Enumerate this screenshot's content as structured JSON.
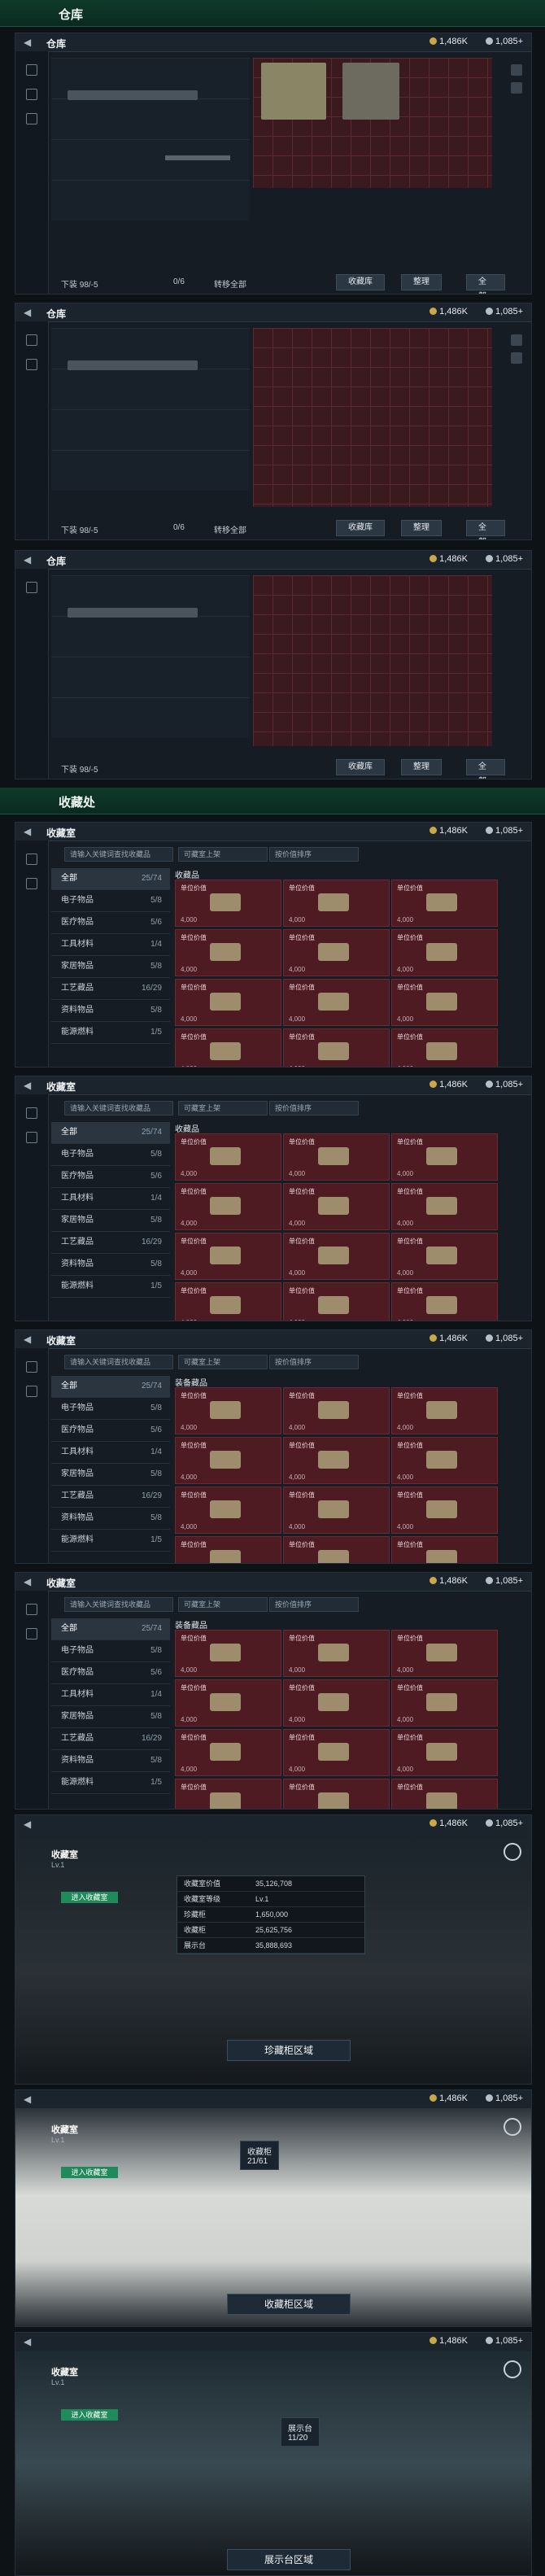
{
  "sections": {
    "warehouse": "仓库",
    "collection": "收藏处"
  },
  "currency": {
    "a": "1,486K",
    "b": "1,085+"
  },
  "warehouse": {
    "title": "仓库",
    "footer": {
      "left": "下装 98/-5",
      "mid": "0/6",
      "right": "转移全部"
    },
    "buttons": [
      "收藏库",
      "整理",
      "全部"
    ]
  },
  "collection": {
    "title": "收藏室",
    "search_placeholder": "请输入关键词查找收藏品",
    "filter1": "可藏室上架",
    "filter2": "按价值排序",
    "section1": "收藏品",
    "section2": "装备藏品",
    "categories": [
      {
        "label": "全部",
        "count": "25/74"
      },
      {
        "label": "电子物品",
        "count": "5/8"
      },
      {
        "label": "医疗物品",
        "count": "5/6"
      },
      {
        "label": "工具材料",
        "count": "1/4"
      },
      {
        "label": "家居物品",
        "count": "5/8"
      },
      {
        "label": "工艺藏品",
        "count": "16/29"
      },
      {
        "label": "资料物品",
        "count": "5/8"
      },
      {
        "label": "能源燃料",
        "count": "1/5"
      }
    ],
    "cell_label": "单位价值",
    "cell_price": "4,000"
  },
  "rooms": {
    "title": "收藏室",
    "level": "Lv.1",
    "enter": "进入收藏室",
    "room1_btn": "珍藏柜区域",
    "room2_btn": "收藏柜区域",
    "room3_btn": "展示台区域",
    "cabinet_label": "收藏柜",
    "cabinet_count": "21/61",
    "display_label": "展示台",
    "display_count": "11/20",
    "table_rows": [
      {
        "k": "收藏室价值",
        "v": "35,126,708"
      },
      {
        "k": "收藏室等级",
        "v": "Lv.1"
      },
      {
        "k": "珍藏柜",
        "v": "1,650,000"
      },
      {
        "k": "收藏柜",
        "v": "25,625,756"
      },
      {
        "k": "展示台",
        "v": "35,888,693"
      }
    ]
  }
}
